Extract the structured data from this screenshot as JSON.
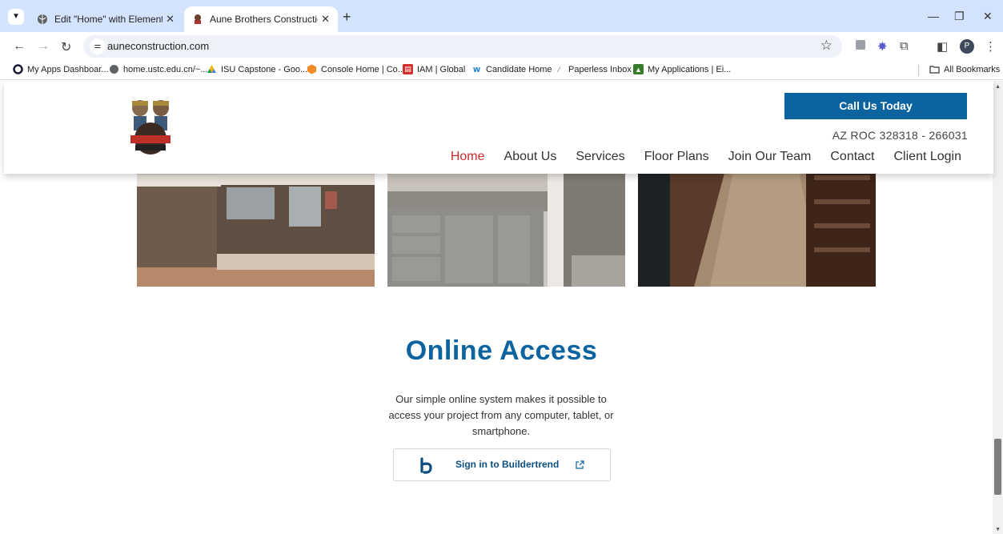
{
  "browser": {
    "tabs": [
      {
        "title": "Edit \"Home\" with Elementor",
        "active": false
      },
      {
        "title": "Aune Brothers Construction",
        "active": true
      }
    ],
    "url": "auneconstruction.com",
    "profile_initial": "P",
    "bookmarks": [
      {
        "label": "My Apps Dashboar...",
        "icon": "okta-icon"
      },
      {
        "label": "home.ustc.edu.cn/~...",
        "icon": "globe-icon"
      },
      {
        "label": "ISU Capstone - Goo...",
        "icon": "drive-icon"
      },
      {
        "label": "Console Home | Co...",
        "icon": "aws-icon"
      },
      {
        "label": "IAM | Global",
        "icon": "iam-icon"
      },
      {
        "label": "Candidate Home",
        "icon": "workday-icon"
      },
      {
        "label": "Paperless Inbox",
        "icon": "paperless-icon"
      },
      {
        "label": "My Applications | Ei...",
        "icon": "deere-icon"
      }
    ],
    "all_bookmarks": "All Bookmarks"
  },
  "site": {
    "call_button": "Call Us Today",
    "roc": "AZ ROC 328318 - 266031",
    "nav": [
      "Home",
      "About Us",
      "Services",
      "Floor Plans",
      "Join Our Team",
      "Contact",
      "Client Login"
    ],
    "active_nav": "Home",
    "section": {
      "title": "Online Access",
      "body": "Our simple online system makes it possible to access your project from any computer, tablet, or smartphone.",
      "button": "Sign in to Buildertrend"
    },
    "gallery": [
      "outdoor-kitchen-photo",
      "bathroom-vanity-photo",
      "walk-in-closet-photo"
    ]
  },
  "colors": {
    "brand_blue": "#0b64a0",
    "nav_active": "#cc2b2b"
  }
}
